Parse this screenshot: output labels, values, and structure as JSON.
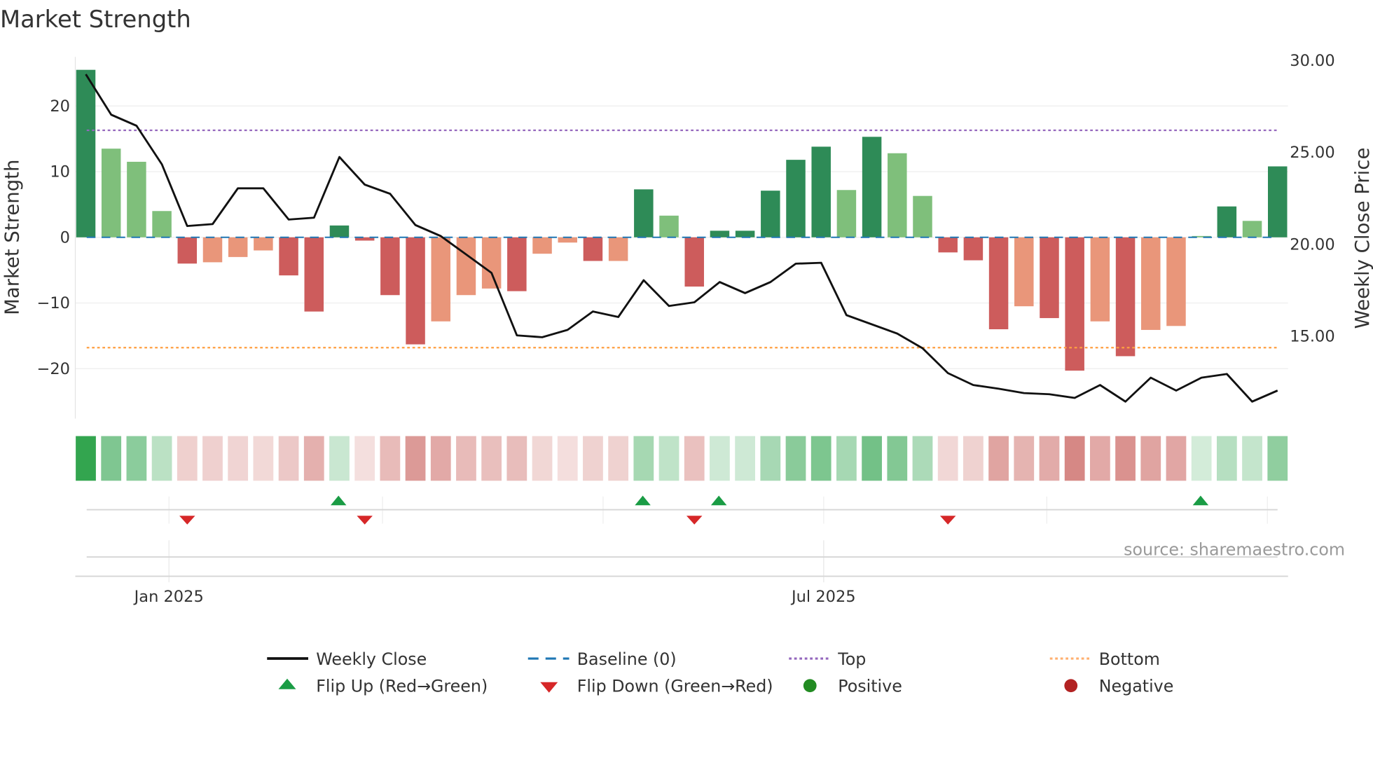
{
  "chart_data": {
    "type": "bar",
    "title": "Market Strength",
    "ylabel": "Market Strength",
    "ylabel_right": "Weekly Close Price",
    "ylim": [
      -27,
      27
    ],
    "ylim_right": [
      10.3,
      30.4
    ],
    "yticks": [
      20,
      10,
      0,
      -10,
      -20
    ],
    "ytick_labels": [
      "20",
      "10",
      "0",
      "−10",
      "−20"
    ],
    "yticks_right": [
      30,
      25,
      20,
      15
    ],
    "ytick_labels_right": [
      "30.00",
      "25.00",
      "20.00",
      "15.00"
    ],
    "xtick_labels": [
      {
        "label": "Jan 2025",
        "week_index": 3.28
      },
      {
        "label": "Jul 2025",
        "week_index": 29.1
      }
    ],
    "minor_grid_week_index": [
      3.28,
      11.7,
      20.4,
      29.1,
      37.9,
      46.6
    ],
    "top_level": 16.3,
    "bottom_level": -16.8,
    "baseline": 0,
    "strength": [
      25.5,
      13.5,
      11.5,
      4.0,
      -4.0,
      -3.8,
      -3.0,
      -2.0,
      -5.8,
      -11.3,
      1.8,
      -0.5,
      -8.8,
      -16.3,
      -12.8,
      -8.8,
      -7.8,
      -8.2,
      -2.5,
      -0.8,
      -3.6,
      -3.6,
      7.3,
      3.3,
      -7.5,
      1.0,
      1.0,
      7.1,
      11.8,
      13.8,
      7.2,
      15.3,
      12.8,
      6.3,
      -2.3,
      -3.5,
      -14.0,
      -10.5,
      -12.3,
      -20.3,
      -12.8,
      -18.1,
      -14.1,
      -13.5,
      0.2,
      4.7,
      2.5,
      10.8
    ],
    "shade": [
      "d",
      "l",
      "l",
      "l",
      "d",
      "l",
      "l",
      "l",
      "d",
      "d",
      "d",
      "d",
      "d",
      "d",
      "l",
      "l",
      "l",
      "d",
      "l",
      "l",
      "d",
      "l",
      "d",
      "l",
      "d",
      "d",
      "d",
      "d",
      "d",
      "d",
      "l",
      "d",
      "l",
      "l",
      "d",
      "d",
      "d",
      "l",
      "d",
      "d",
      "l",
      "d",
      "l",
      "l",
      "l",
      "d",
      "l",
      "d"
    ],
    "weekly_close": [
      29.2,
      27.0,
      26.4,
      24.3,
      20.95,
      21.05,
      23.0,
      23.0,
      21.3,
      21.4,
      24.7,
      23.2,
      22.7,
      21.0,
      20.4,
      19.4,
      18.4,
      15.0,
      14.9,
      15.3,
      16.3,
      16.0,
      18.0,
      16.6,
      16.8,
      17.9,
      17.3,
      17.9,
      18.9,
      18.95,
      16.1,
      15.6,
      15.1,
      14.3,
      12.95,
      12.3,
      12.1,
      11.86,
      11.8,
      11.6,
      12.3,
      11.4,
      12.7,
      12.0,
      12.7,
      12.9,
      11.4,
      12.0
    ],
    "flip_up_indices": [
      10,
      22,
      25,
      44
    ],
    "flip_down_indices": [
      4,
      11,
      24,
      34
    ],
    "legend": {
      "weekly_close": "Weekly Close",
      "baseline": "Baseline (0)",
      "top": "Top",
      "bottom": "Bottom",
      "flip_up": "Flip Up (Red→Green)",
      "flip_down": "Flip Down (Green→Red)",
      "positive": "Positive",
      "negative": "Negative"
    },
    "source": "source: sharemaestro.com",
    "colors": {
      "pos_dark": "#2e8b57",
      "pos_light": "#7fbf7b",
      "neg_dark": "#cd5c5c",
      "neg_light": "#e9967a",
      "line": "#111111",
      "baseline": "#1f77b4",
      "top": "#9467bd",
      "bottom": "#ff9f40",
      "flip_up": "#1a9c45",
      "flip_down": "#d62728",
      "positive": "#228b22",
      "negative": "#b22222"
    }
  }
}
